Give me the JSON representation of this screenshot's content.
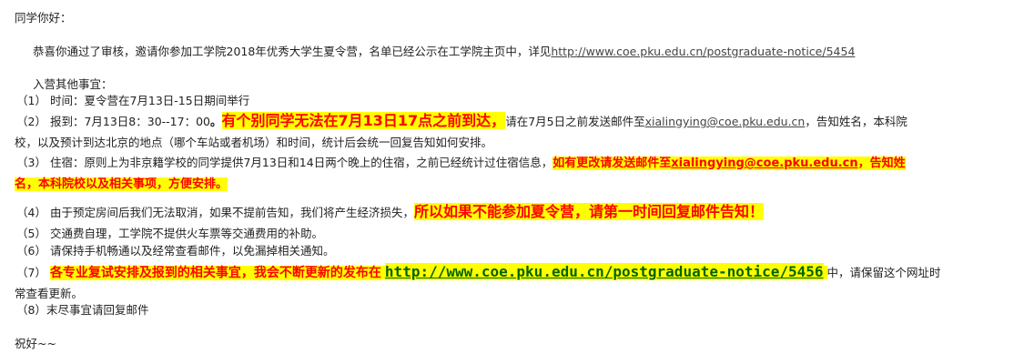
{
  "greeting": "同学你好：",
  "p1": {
    "text": "恭喜你通过了审核，邀请你参加工学院2018年优秀大学生夏令营，名单已经公示在工学院主页中，详见",
    "link": "http://www.coe.pku.edu.cn/postgraduate-notice/5454"
  },
  "section_title": "入营其他事宜：",
  "item1": {
    "num": "（1）",
    "text": "时间：夏令营在7月13日-15日期间举行"
  },
  "item2": {
    "num": "（2）",
    "prefix": "报到：7月13日8：30--17：00",
    "dot": "。",
    "highlight": "有个别同学无法在7月13日17点之前到达，",
    "mid": "请在7月5日之前发送邮件至",
    "email": "xialingying@coe.pku.edu.cn",
    "suffix": "，告知姓名，本科院",
    "line2": "校，以及预计到达北京的地点（哪个车站或者机场）和时间，统计后会统一回复告知如何安排。"
  },
  "item3": {
    "num": "（3）",
    "prefix": "住宿：原则上为非京籍学校的同学提供7月13日和14日两个晚上的住宿，之前已经统计过住宿信息，",
    "hl_prefix": "如有更改请发送邮件至",
    "email": "xialingying@coe.pku.edu.cn",
    "hl_suffix": "，告知姓",
    "line2": "名，本科院校以及相关事项，方便安排。"
  },
  "item4": {
    "num": "（4）",
    "text": "由于预定房间后我们无法取消，如果不提前告知，我们将产生经济损失，",
    "highlight": "所以如果不能参加夏令营，请第一时间回复邮件告知！"
  },
  "item5": {
    "num": "（5）",
    "text": "交通费自理，工学院不提供火车票等交通费用的补助。"
  },
  "item6": {
    "num": "（6）",
    "text": "请保持手机畅通以及经常查看邮件，以免漏掉相关通知。"
  },
  "item7": {
    "num": "（7）",
    "highlight": "各专业复试安排及报到的相关事宜，我会不断更新的发布在",
    "link": "http://www.coe.pku.edu.cn/postgraduate-notice/5456",
    "suffix": "中，请保留这个网址时",
    "line2": "常查看更新。"
  },
  "item8": {
    "num": "（8）",
    "text": "末尽事宜请回复邮件"
  },
  "closing": "祝好~~"
}
